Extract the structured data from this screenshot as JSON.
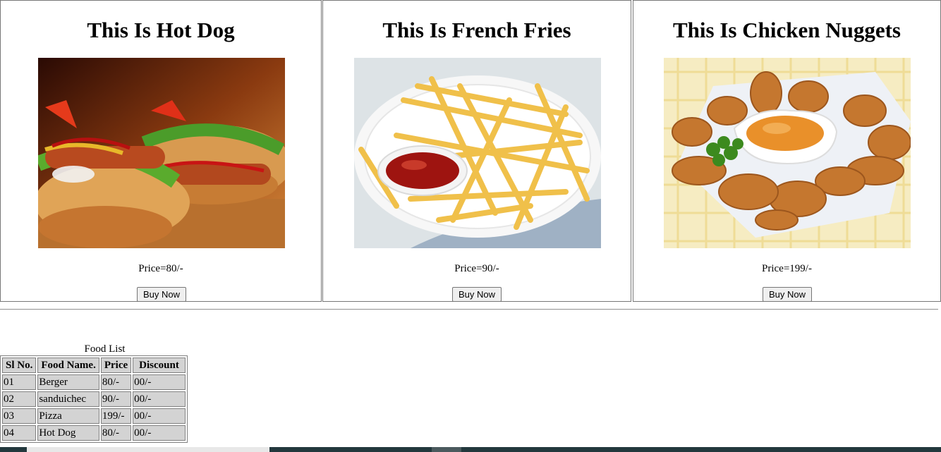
{
  "cards": [
    {
      "title": "This Is Hot Dog",
      "price": "Price=80/-",
      "button": "Buy Now",
      "image": "hot-dog-image"
    },
    {
      "title": "This Is French Fries",
      "price": "Price=90/-",
      "button": "Buy Now",
      "image": "french-fries-image"
    },
    {
      "title": "This Is Chicken Nuggets",
      "price": "Price=199/-",
      "button": "Buy Now",
      "image": "chicken-nuggets-image"
    }
  ],
  "table": {
    "caption": "Food List",
    "headers": [
      "Sl No.",
      "Food Name.",
      "Price",
      "Discount"
    ],
    "rows": [
      [
        "01",
        "Berger",
        "80/-",
        "00/-"
      ],
      [
        "02",
        "sanduichec",
        "90/-",
        "00/-"
      ],
      [
        "03",
        "Pizza",
        "199/-",
        "00/-"
      ],
      [
        "04",
        "Hot Dog",
        "80/-",
        "00/-"
      ]
    ]
  },
  "colors": {
    "table_cell_bg": "#d3d3d3",
    "taskbar": "#23383d"
  }
}
